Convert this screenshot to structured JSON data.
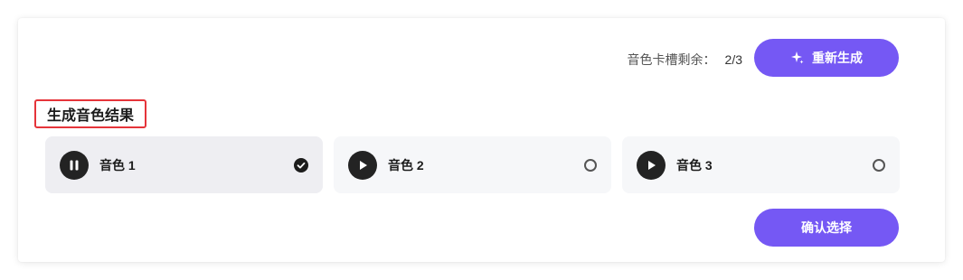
{
  "header": {
    "quota_label": "音色卡槽剩余：",
    "quota_value": "2/3",
    "regenerate_label": "重新生成"
  },
  "section": {
    "title": "生成音色结果"
  },
  "options": [
    {
      "label": "音色 1",
      "state": "playing",
      "selected": true
    },
    {
      "label": "音色 2",
      "state": "paused",
      "selected": false
    },
    {
      "label": "音色 3",
      "state": "paused",
      "selected": false
    }
  ],
  "footer": {
    "confirm_label": "确认选择"
  },
  "colors": {
    "accent": "#7558f4",
    "highlight_border": "#e5343a",
    "selected_bg": "#eeeef2",
    "option_bg": "#f6f7f9"
  }
}
